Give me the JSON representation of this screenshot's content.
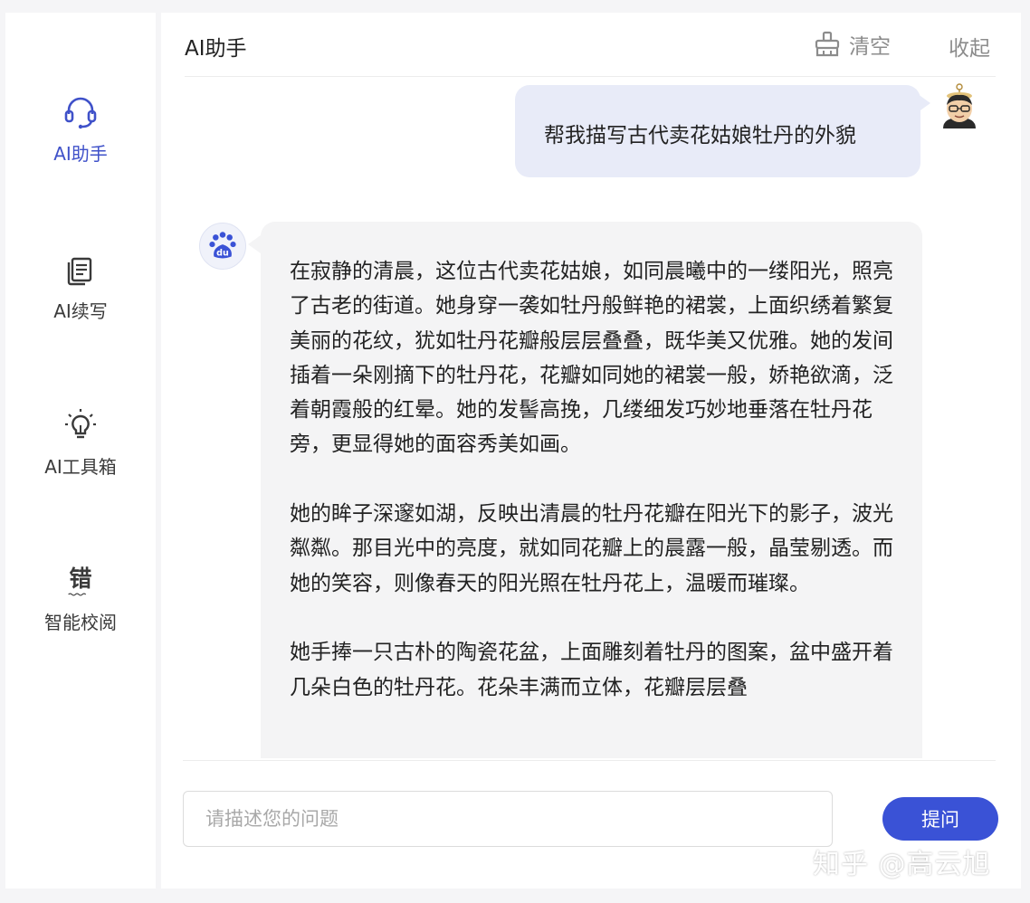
{
  "sidebar": {
    "items": [
      {
        "label": "AI助手",
        "icon": "headset-icon",
        "active": true
      },
      {
        "label": "AI续写",
        "icon": "document-copy-icon",
        "active": false
      },
      {
        "label": "AI工具箱",
        "icon": "lightbulb-icon",
        "active": false
      },
      {
        "label": "智能校阅",
        "icon": "proofread-icon",
        "icon_text": "错",
        "active": false
      }
    ]
  },
  "header": {
    "title": "AI助手",
    "clear_label": "清空",
    "collapse_label": "收起"
  },
  "chat": {
    "user_message": "帮我描写古代卖花姑娘牡丹的外貌",
    "bot_paragraphs": [
      "在寂静的清晨，这位古代卖花姑娘，如同晨曦中的一缕阳光，照亮了古老的街道。她身穿一袭如牡丹般鲜艳的裙裳，上面织绣着繁复美丽的花纹，犹如牡丹花瓣般层层叠叠，既华美又优雅。她的发间插着一朵刚摘下的牡丹花，花瓣如同她的裙裳一般，娇艳欲滴，泛着朝霞般的红晕。她的发髻高挽，几缕细发巧妙地垂落在牡丹花旁，更显得她的面容秀美如画。",
      "她的眸子深邃如湖，反映出清晨的牡丹花瓣在阳光下的影子，波光粼粼。那目光中的亮度，就如同花瓣上的晨露一般，晶莹剔透。而她的笑容，则像春天的阳光照在牡丹花上，温暖而璀璨。",
      "她手捧一只古朴的陶瓷花盆，上面雕刻着牡丹的图案，盆中盛开着几朵白色的牡丹花。花朵丰满而立体，花瓣层层叠"
    ]
  },
  "input": {
    "placeholder": "请描述您的问题",
    "value": ""
  },
  "ask_button_label": "提问",
  "watermark": "知乎 @高云旭",
  "colors": {
    "accent": "#3a52d6",
    "active_nav": "#3f51c9",
    "user_bubble": "#e8ebf8",
    "bot_bubble": "#f4f4f5"
  }
}
